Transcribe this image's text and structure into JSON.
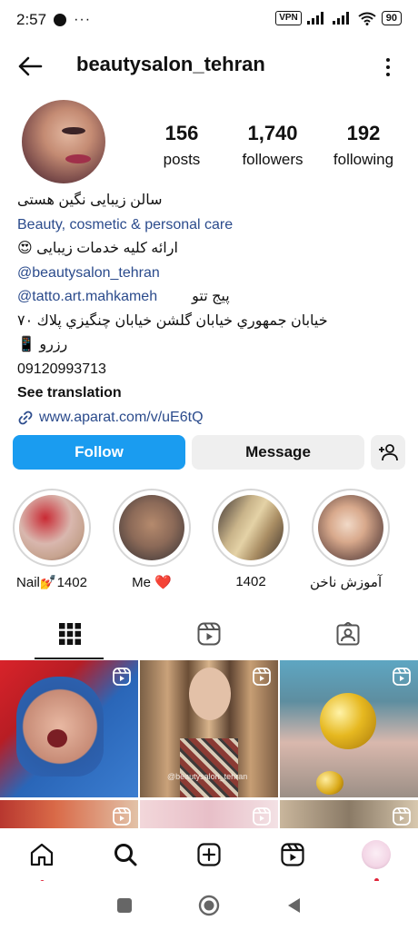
{
  "status_bar": {
    "time": "2:57",
    "more": "···",
    "vpn": "VPN",
    "battery": "90"
  },
  "header": {
    "username": "beautysalon_tehran"
  },
  "profile": {
    "stats": [
      {
        "value": "156",
        "label": "posts"
      },
      {
        "value": "1,740",
        "label": "followers"
      },
      {
        "value": "192",
        "label": "following"
      }
    ],
    "bio": {
      "name": "سالن زیبایی نگین هستی",
      "category": "Beauty, cosmetic & personal care",
      "line1": "ارائه کلیه خدمات زیبایی 😍",
      "mention1": "@beautysalon_tehran",
      "mention2": "@tatto.art.mahkameh",
      "mention2_label": "پیج تتو",
      "address": "خیابان جمهوري خیابان گلشن خیابان چنگیزي پلاك ۷۰",
      "reserve": "رزرو 📱",
      "phone": "09120993713",
      "see_translation": "See translation",
      "link": "www.aparat.com/v/uE6tQ"
    }
  },
  "actions": {
    "follow": "Follow",
    "message": "Message"
  },
  "highlights": [
    {
      "label": "Nail💅1402"
    },
    {
      "label": "Me ❤️"
    },
    {
      "label": "1402"
    },
    {
      "label": "آموزش ناخن"
    }
  ],
  "grid": {
    "caption": "@beautysalon_tehran"
  },
  "colors": {
    "follow_button": "#1a9cf0",
    "link": "#2b4b8c",
    "notification_dot": "#e0243a"
  }
}
